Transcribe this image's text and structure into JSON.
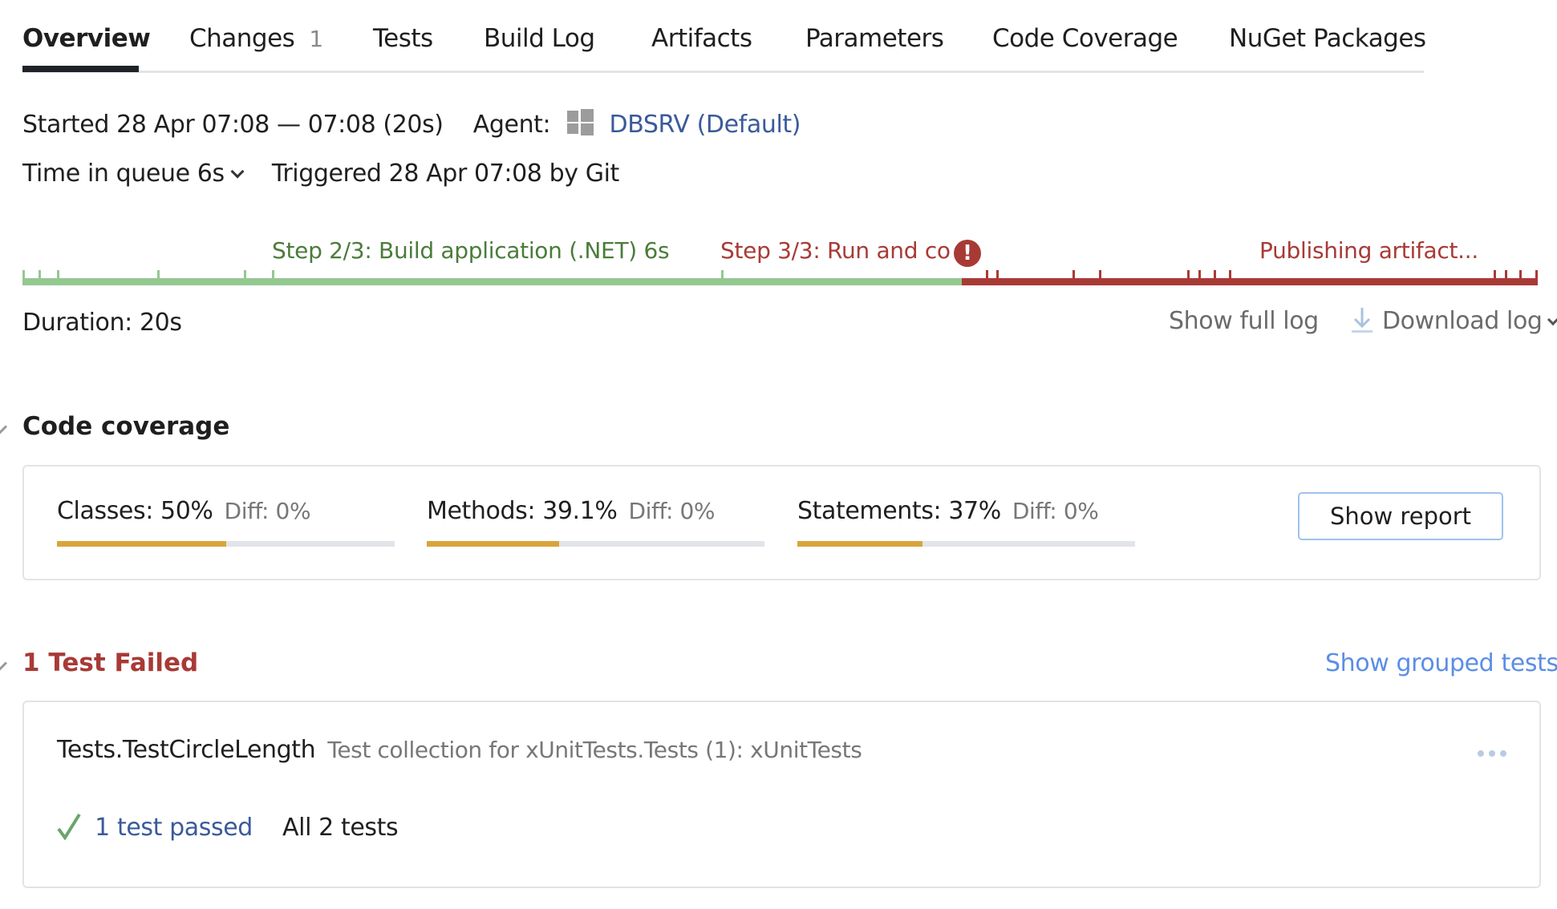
{
  "tabs": [
    {
      "label": "Overview",
      "active": true
    },
    {
      "label": "Changes",
      "count": "1"
    },
    {
      "label": "Tests"
    },
    {
      "label": "Build Log"
    },
    {
      "label": "Artifacts"
    },
    {
      "label": "Parameters"
    },
    {
      "label": "Code Coverage"
    },
    {
      "label": "NuGet Packages"
    }
  ],
  "build_info": {
    "started": "Started 28 Apr 07:08 — 07:08 (20s)",
    "agent_label": "Agent:",
    "agent_icon": "windows-icon",
    "agent_name": "DBSRV",
    "agent_pool": "(Default)",
    "time_in_queue": "Time in queue 6s",
    "triggered": "Triggered 28 Apr 07:08 by Git"
  },
  "timeline": {
    "steps": [
      {
        "label": "Step 2/3: Build application (.NET) 6s",
        "status": "success"
      },
      {
        "label": "Step 3/3: Run and co",
        "status": "failed"
      },
      {
        "label": "Publishing artifact...",
        "status": "failed"
      }
    ],
    "error_icon": "exclamation-icon",
    "success_fraction": 0.62,
    "colors": {
      "success": "#94c890",
      "failed": "#a83a36"
    },
    "duration": "Duration: 20s",
    "show_full_log": "Show full log",
    "download_log": "Download log"
  },
  "code_coverage": {
    "title": "Code coverage",
    "metrics": [
      {
        "label": "Classes: 50%",
        "diff": "Diff: 0%",
        "percent": 50
      },
      {
        "label": "Methods: 39.1%",
        "diff": "Diff: 0%",
        "percent": 39.1
      },
      {
        "label": "Statements: 37%",
        "diff": "Diff: 0%",
        "percent": 37
      }
    ],
    "show_report": "Show report",
    "bar_color": "#d9a43a"
  },
  "tests": {
    "title": "1 Test Failed",
    "show_grouped": "Show grouped tests",
    "items": [
      {
        "name": "Tests.TestCircleLength",
        "collection": "Test collection for xUnitTests.Tests (1): xUnitTests",
        "passed_link": "1 test passed",
        "all_tests": "All 2 tests"
      }
    ]
  }
}
